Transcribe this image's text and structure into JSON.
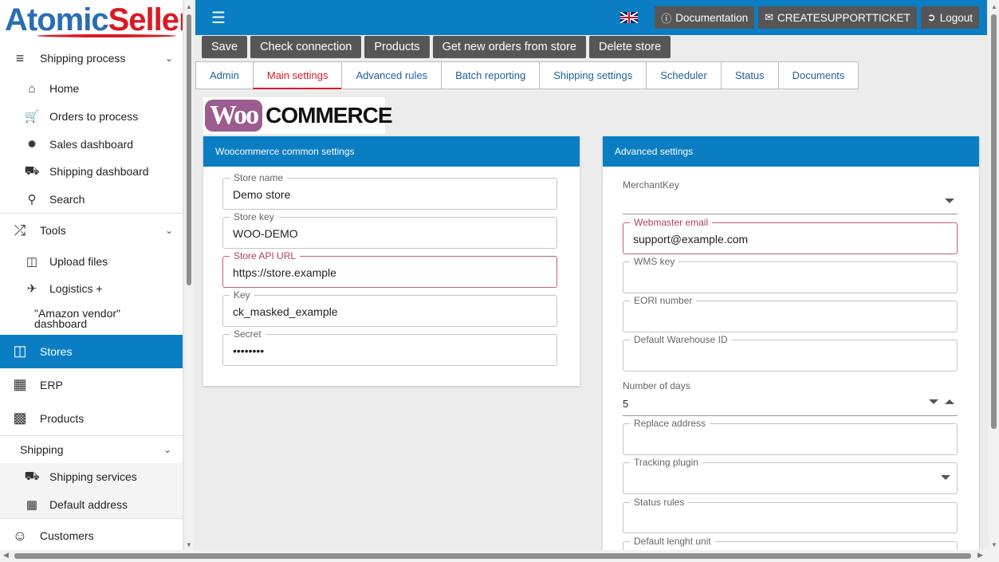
{
  "brand": {
    "logo_part1": "Atomic",
    "logo_part2": "Seller"
  },
  "sidebar": {
    "shipping_process": {
      "label": "Shipping process",
      "items": [
        {
          "label": "Home"
        },
        {
          "label": "Orders to process"
        },
        {
          "label": "Sales dashboard"
        },
        {
          "label": "Shipping dashboard"
        },
        {
          "label": "Search"
        }
      ]
    },
    "tools": {
      "label": "Tools",
      "items": [
        {
          "label": "Upload files"
        },
        {
          "label": "Logistics +"
        },
        {
          "label": "\"Amazon vendor\" dashboard"
        }
      ]
    },
    "stores": {
      "label": "Stores"
    },
    "erp": {
      "label": "ERP"
    },
    "products": {
      "label": "Products"
    },
    "shipping": {
      "label": "Shipping",
      "items": [
        {
          "label": "Shipping services"
        },
        {
          "label": "Default address"
        }
      ]
    },
    "customers": {
      "label": "Customers"
    }
  },
  "topbar": {
    "documentation": "Documentation",
    "support": "CREATESUPPORTTICKET",
    "logout": "Logout"
  },
  "actions": [
    "Save",
    "Check connection",
    "Products",
    "Get new orders from store",
    "Delete store"
  ],
  "tabs": [
    "Admin",
    "Main settings",
    "Advanced rules",
    "Batch reporting",
    "Shipping settings",
    "Scheduler",
    "Status",
    "Documents"
  ],
  "woo_logo": {
    "woo": "Woo",
    "commerce": "COMMERCE"
  },
  "left_card": {
    "title": "Woocommerce common settings",
    "store_name": {
      "label": "Store name",
      "value": "Demo store"
    },
    "store_key": {
      "label": "Store key",
      "value": "WOO-DEMO"
    },
    "store_api_url": {
      "label": "Store API URL",
      "value": "https://store.example"
    },
    "key": {
      "label": "Key",
      "value": "ck_masked_example"
    },
    "secret": {
      "label": "Secret",
      "value": "••••••••"
    }
  },
  "right_card": {
    "title": "Advanced settings",
    "merchant_key": {
      "label": "MerchantKey",
      "value": ""
    },
    "webmaster_email": {
      "label": "Webmaster email",
      "value": "support@example.com"
    },
    "wms_key": {
      "label": "WMS key",
      "value": ""
    },
    "eori_number": {
      "label": "EORI number",
      "value": ""
    },
    "default_warehouse_id": {
      "label": "Default Warehouse ID",
      "value": ""
    },
    "number_of_days": {
      "label": "Number of days",
      "value": "5"
    },
    "replace_address": {
      "label": "Replace address",
      "value": ""
    },
    "tracking_plugin": {
      "label": "Tracking plugin",
      "value": ""
    },
    "status_rules": {
      "label": "Status rules",
      "value": ""
    },
    "default_length_unit": {
      "label": "Default lenght unit",
      "value": ""
    }
  },
  "colors": {
    "primary": "#0b7ec3",
    "accent_red": "#d71b24",
    "button_gray": "#565656",
    "woo_purple": "#9b5c8f"
  }
}
